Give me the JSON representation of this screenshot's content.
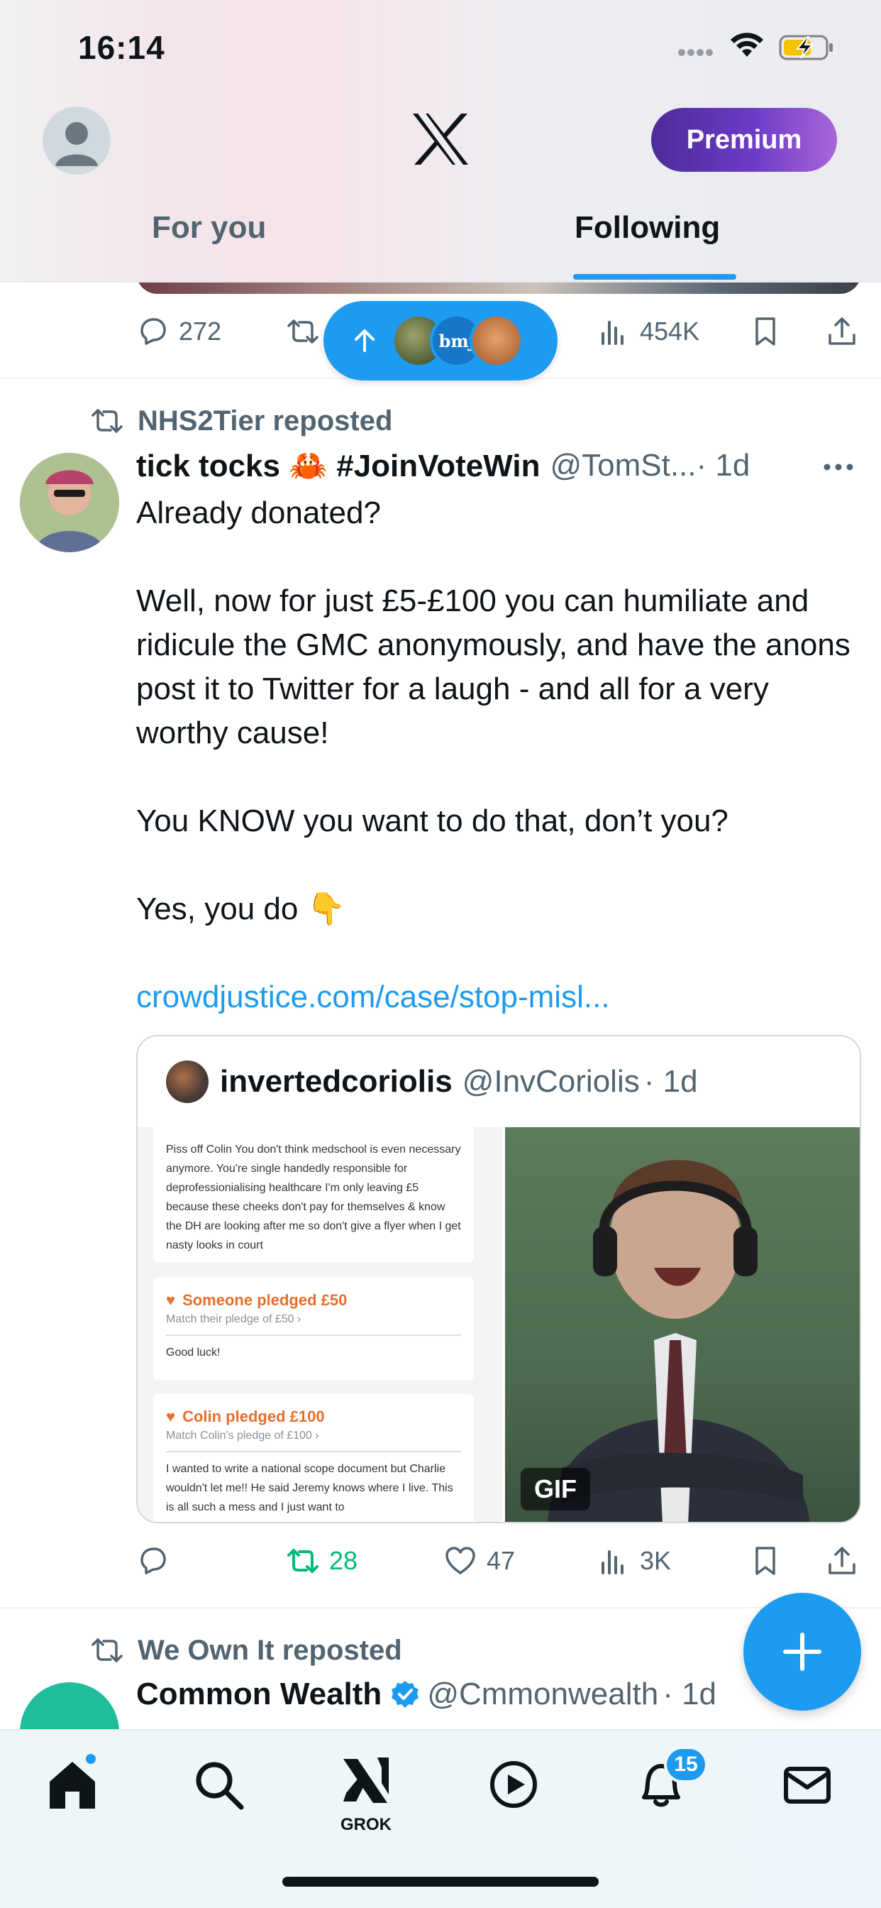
{
  "status_bar": {
    "time": "16:14"
  },
  "header": {
    "logo": "x-logo",
    "premium_label": "Premium",
    "tabs": [
      {
        "label": "For you",
        "active": false
      },
      {
        "label": "Following",
        "active": true
      }
    ]
  },
  "previous_tweet": {
    "replies": "272",
    "views": "454K"
  },
  "new_posts_pill": {
    "avatars": [
      "avatar-1",
      "bmj",
      "avatar-3"
    ],
    "bmj_label": "bmj"
  },
  "tweet": {
    "repost_by": "NHS2Tier reposted",
    "author_name": "tick tocks 🦀 #JoinVoteWin",
    "author_handle": "@TomSt...",
    "time": "· 1d",
    "paragraphs": [
      "Already donated?",
      "Well, now for just £5-£100 you can humiliate and ridicule the GMC anonymously, and have the anons post it to Twitter for a laugh - and all for a very worthy cause!",
      "You KNOW you want to do that, don’t you?",
      "Yes, you do 👇"
    ],
    "link": "crowdjustice.com/case/stop-misl...",
    "quote": {
      "author_name": "invertedcoriolis",
      "author_handle": "@InvCoriolis",
      "time": "· 1d",
      "card1_text": "Piss off Colin You don't think medschool is even necessary anymore. You're single handedly responsible for deprofessionialising healthcare I'm only leaving £5 because these cheeks don't pay for themselves & know the DH are looking after me so don't give a flyer when I get nasty looks in court",
      "card2_title": "Someone pledged £50",
      "card2_match": "Match their pledge of £50 ›",
      "card2_text": "Good luck!",
      "card3_title": "Colin pledged £100",
      "card3_match": "Match Colin's pledge of £100 ›",
      "card3_text": "I wanted to write a national scope document but Charlie wouldn't let me!! He said Jeremy knows where I live. This is all such a mess and I just want to",
      "gif_label": "GIF"
    },
    "stats": {
      "replies": "",
      "reposts": "28",
      "likes": "47",
      "views": "3K"
    }
  },
  "next_tweet": {
    "repost_by": "We Own It reposted",
    "author_name": "Common Wealth",
    "author_handle": "@Cmmonwealth",
    "time": "· 1d"
  },
  "bottom_nav": {
    "items": [
      "home-icon",
      "search-icon",
      "grok-icon",
      "video-icon",
      "notifications-icon",
      "messages-icon"
    ],
    "grok_label": "GROK",
    "notifications_count": "15"
  },
  "colors": {
    "accent": "#1d9bf0",
    "text": "#0f1419",
    "muted": "#536471",
    "repost_green": "#00ba7c",
    "premium_purple": "#5a2fb0"
  }
}
